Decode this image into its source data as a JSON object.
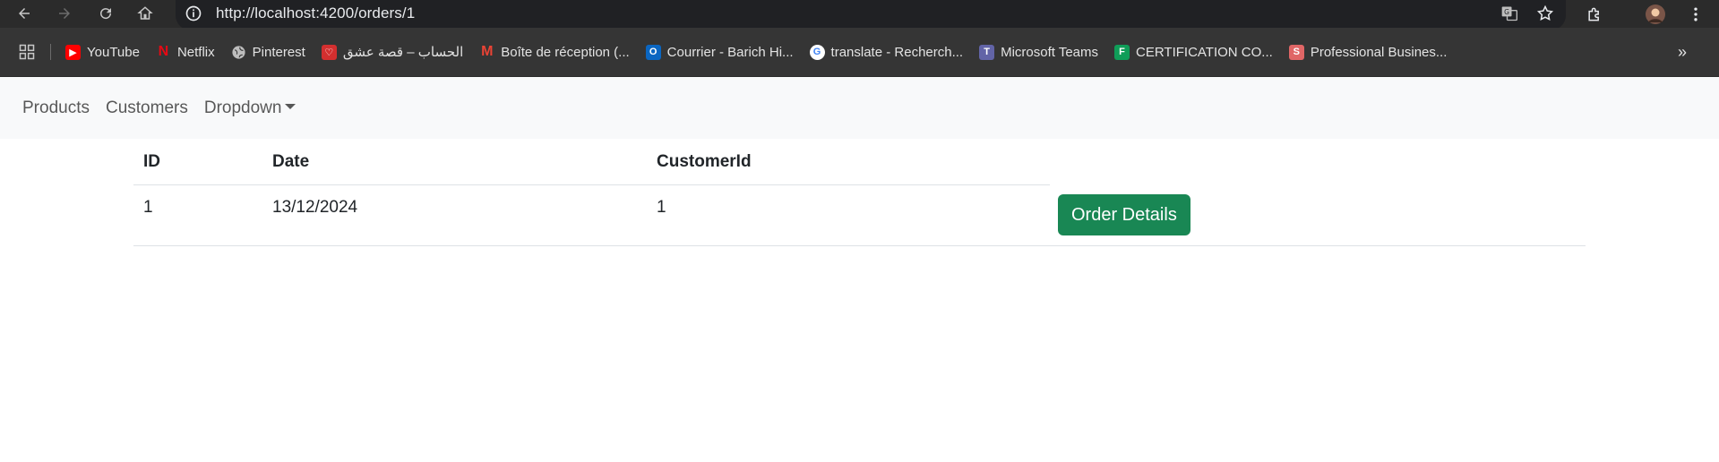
{
  "browser": {
    "url": "http://localhost:4200/orders/1",
    "bookmarks": [
      {
        "label": "YouTube",
        "icon": "youtube-icon",
        "color": "#ff0000"
      },
      {
        "label": "Netflix",
        "icon": "netflix-icon",
        "color": "#e50914"
      },
      {
        "label": "Pinterest",
        "icon": "globe-icon",
        "color": "#9e9e9e"
      },
      {
        "label": "الحساب – قصة عشق",
        "icon": "heart-icon",
        "color": "#d32f2f"
      },
      {
        "label": "Boîte de réception (...",
        "icon": "gmail-icon",
        "color": "#ea4335"
      },
      {
        "label": "Courrier - Barich Hi...",
        "icon": "outlook-icon",
        "color": "#0a66c2"
      },
      {
        "label": "translate - Recherch...",
        "icon": "google-icon",
        "color": "#4285f4"
      },
      {
        "label": "Microsoft Teams",
        "icon": "teams-icon",
        "color": "#6264a7"
      },
      {
        "label": "CERTIFICATION CO...",
        "icon": "forms-icon",
        "color": "#0f9d58"
      },
      {
        "label": "Professional Busines...",
        "icon": "s-icon",
        "color": "#e06666"
      }
    ]
  },
  "navbar": {
    "products": "Products",
    "customers": "Customers",
    "dropdown": "Dropdown"
  },
  "table": {
    "headers": [
      "ID",
      "Date",
      "CustomerId"
    ],
    "rows": [
      {
        "id": "1",
        "date": "13/12/2024",
        "customer_id": "1",
        "action_label": "Order Details"
      }
    ]
  },
  "colors": {
    "accent_success": "#198754",
    "navbar_bg": "#f8f9fa"
  }
}
